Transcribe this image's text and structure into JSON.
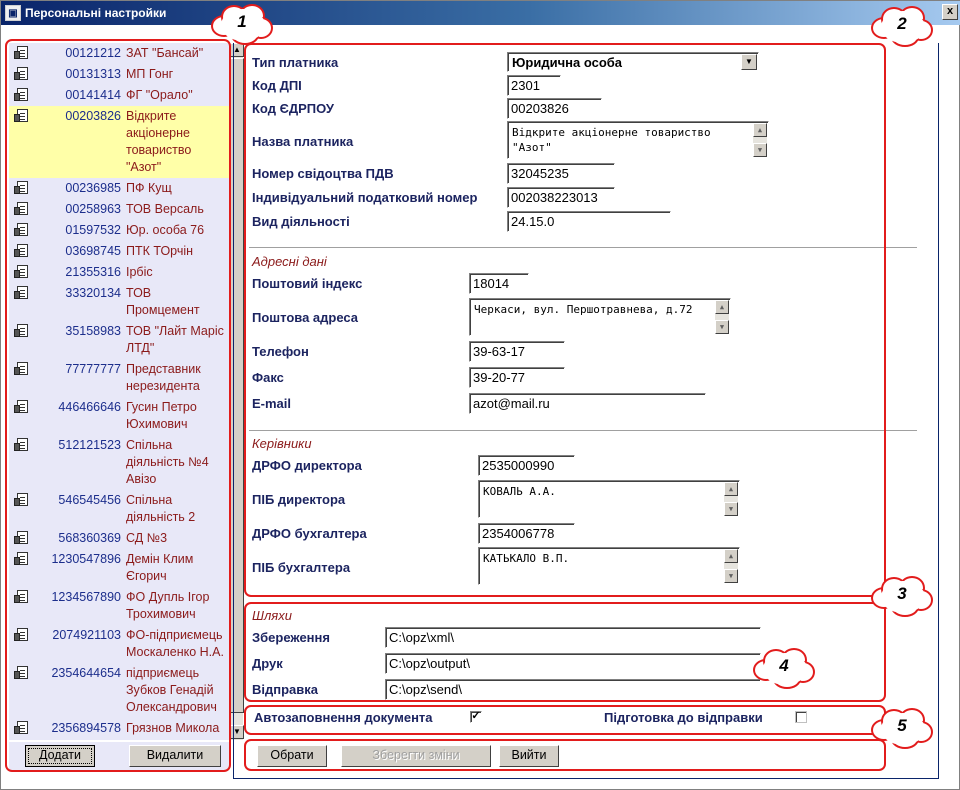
{
  "window": {
    "title": "Персональні настройки",
    "close_label": "x"
  },
  "list": [
    {
      "code": "00121212",
      "name": "ЗАТ \"Бансай\""
    },
    {
      "code": "00131313",
      "name": "МП Гонг"
    },
    {
      "code": "00141414",
      "name": "ФГ \"Орало\""
    },
    {
      "code": "00203826",
      "name": "Відкрите акціонерне товариство \"Азот\"",
      "selected": true
    },
    {
      "code": "00236985",
      "name": "ПФ Кущ"
    },
    {
      "code": "00258963",
      "name": "ТОВ Версаль"
    },
    {
      "code": "01597532",
      "name": "Юр. особа 76"
    },
    {
      "code": "03698745",
      "name": "ПТК ТОрчін"
    },
    {
      "code": "21355316",
      "name": "Ірбіс"
    },
    {
      "code": "33320134",
      "name": "ТОВ Промцемент"
    },
    {
      "code": "35158983",
      "name": "ТОВ \"Лайт Маріс ЛТД\""
    },
    {
      "code": "77777777",
      "name": "Представник нерезидента"
    },
    {
      "code": "446466646",
      "name": "Гусин Петро Юхимович"
    },
    {
      "code": "512121523",
      "name": "Спільна діяльність №4 Авізо"
    },
    {
      "code": "546545456",
      "name": "Спільна діяльність 2"
    },
    {
      "code": "568360369",
      "name": "СД №3"
    },
    {
      "code": "1230547896",
      "name": "Демін Клим Єгорич"
    },
    {
      "code": "1234567890",
      "name": "ФО Дупль Ігор Трохимович"
    },
    {
      "code": "2074921103",
      "name": "ФО-підприємець Москаленко Н.А."
    },
    {
      "code": "2354644654",
      "name": "підприємець Зубков Генадій Олександрович"
    },
    {
      "code": "2356894578",
      "name": "Грязнов Микола"
    }
  ],
  "left_buttons": {
    "add": "Додати",
    "delete": "Видалити"
  },
  "form": {
    "payer_type_label": "Тип платника",
    "payer_type_value": "Юридична особа",
    "dpi_label": "Код ДПІ",
    "dpi_value": "2301",
    "edrpou_label": "Код ЄДРПОУ",
    "edrpou_value": "00203826",
    "name_label": "Назва платника",
    "name_value": "Відкрите акціонерне товариство \"Азот\"",
    "vat_label": "Номер свідоцтва ПДВ",
    "vat_value": "32045235",
    "tax_id_label": "Індивідуальний податковий номер",
    "tax_id_value": "002038223013",
    "activity_label": "Вид діяльності",
    "activity_value": "24.15.0"
  },
  "address": {
    "section_title": "Адресні дані",
    "index_label": "Поштовий індекс",
    "index_value": "18014",
    "postal_label": "Поштова адреса",
    "postal_value": "Черкаси, вул. Першотравнева, д.72",
    "phone_label": "Телефон",
    "phone_value": "39-63-17",
    "fax_label": "Факс",
    "fax_value": "39-20-77",
    "email_label": "E-mail",
    "email_value": "azot@mail.ru"
  },
  "managers": {
    "section_title": "Керівники",
    "dir_drfo_label": "ДРФО директора",
    "dir_drfo_value": "2535000990",
    "dir_name_label": "ПІБ директора",
    "dir_name_value": "КОВАЛЬ А.А.",
    "acc_drfo_label": "ДРФО бухгалтера",
    "acc_drfo_value": "2354006778",
    "acc_name_label": "ПІБ бухгалтера",
    "acc_name_value": "КАТЬКАЛО В.П."
  },
  "paths": {
    "section_title": "Шляхи",
    "save_label": "Збереження",
    "save_value": "C:\\opz\\xml\\",
    "print_label": "Друк",
    "print_value": "C:\\opz\\output\\",
    "send_label": "Відправка",
    "send_value": "C:\\opz\\send\\"
  },
  "options": {
    "autofill_label": "Автозаповнення документа",
    "autofill_checked": true,
    "prepare_label": "Підготовка до відправки",
    "prepare_checked": false
  },
  "bottom_buttons": {
    "select": "Обрати",
    "save": "Зберегти зміни",
    "exit": "Вийти"
  },
  "annotations": [
    "1",
    "2",
    "3",
    "4",
    "5"
  ],
  "colors": {
    "annotation": "#e21c1c",
    "selected_row": "#ffffa8",
    "list_bg": "#e8e8f8",
    "label": "#1c2460",
    "section": "#8b1a1a"
  }
}
